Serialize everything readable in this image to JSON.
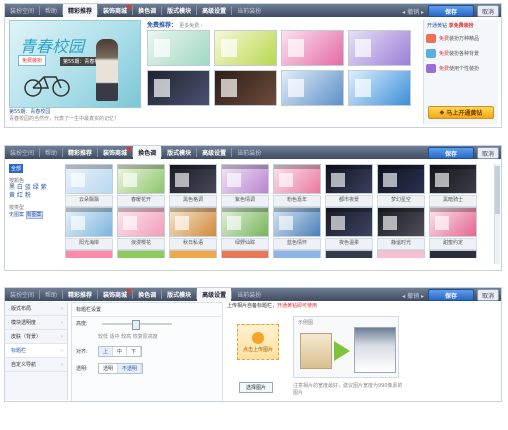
{
  "colors": {
    "accent": "#2a6acb",
    "toolbar": "#4f5d73",
    "save": "#3a7fd8",
    "vip": "#f2a913"
  },
  "panel1": {
    "toolbar": {
      "tabs": [
        {
          "label": "装扮空间",
          "type": "sub"
        },
        {
          "label": "帮助",
          "type": "sub"
        },
        {
          "label": "精彩推荐",
          "type": "active"
        },
        {
          "label": "装饰商城",
          "type": "bold",
          "badge": true
        },
        {
          "label": "换色调",
          "type": "bold"
        },
        {
          "label": "版式模块",
          "type": "bold"
        },
        {
          "label": "高级设置",
          "type": "bold"
        },
        {
          "label": "当前装扮",
          "type": "sub"
        }
      ],
      "nav": "◂ 撤销 ▸",
      "save_label": "保存",
      "cancel_label": "取消"
    },
    "featured": {
      "title": "青春校园",
      "badge": "免费装扮",
      "sub": "第55期：青春校园",
      "caption1": "第55期：青春校园",
      "caption2": "青春校园的当然作，代表了一生中最真实的记忆！"
    },
    "grid": {
      "title": "免费推荐：",
      "sub": "更多免费 ›",
      "items": [
        {
          "name": "t1",
          "c1": "#eaf6f0",
          "c2": "#9fd8c0"
        },
        {
          "name": "t2",
          "c1": "#f6f9d6",
          "c2": "#b8d84e"
        },
        {
          "name": "t3",
          "c1": "#fbe1ef",
          "c2": "#e46aa5"
        },
        {
          "name": "t4",
          "c1": "#e7e0f6",
          "c2": "#9a7fd6"
        },
        {
          "name": "t5",
          "c1": "#1f2230",
          "c2": "#4b5270"
        },
        {
          "name": "t6",
          "c1": "#2c1e1a",
          "c2": "#6e4b3b"
        },
        {
          "name": "t7",
          "c1": "#e2eef9",
          "c2": "#5c8fc7"
        },
        {
          "name": "t8",
          "c1": "#dcefff",
          "c2": "#3d8fd8"
        }
      ]
    },
    "side": {
      "title_pre": "开通黄钻",
      "title_hl": "享免费装扮",
      "items": [
        {
          "pre": "免费",
          "text": "装扮万种精品",
          "color": "#f06f55"
        },
        {
          "pre": "免费",
          "text": "装扮各种背景",
          "color": "#5aaee0"
        },
        {
          "pre": "免费",
          "text": "使用个性装扮",
          "color": "#9a6fd6"
        }
      ],
      "vip_label": "马上开通黄钻"
    }
  },
  "panel2": {
    "toolbar": {
      "tabs": [
        {
          "label": "装扮空间",
          "type": "sub"
        },
        {
          "label": "帮助",
          "type": "sub"
        },
        {
          "label": "精彩推荐",
          "type": "bold"
        },
        {
          "label": "装饰商城",
          "type": "bold",
          "badge": true
        },
        {
          "label": "换色调",
          "type": "active"
        },
        {
          "label": "版式模块",
          "type": "bold"
        },
        {
          "label": "高级设置",
          "type": "bold"
        },
        {
          "label": "当前装扮",
          "type": "sub"
        }
      ],
      "save_label": "保存",
      "cancel_label": "取消"
    },
    "filter": {
      "all": "全部",
      "by_color": "按颜色",
      "colors": "黑 白 蓝 绿 紫 黄 红 粉",
      "by_type": "按类型",
      "types": [
        "无图案",
        "有图案"
      ]
    },
    "cards": [
      {
        "name": "云朵飘飘",
        "c1": "#e9f3fb",
        "c2": "#b9d7ef"
      },
      {
        "name": "春暖花开",
        "c1": "#f0f7e2",
        "c2": "#8cc56a"
      },
      {
        "name": "黑色格调",
        "c1": "#1b1b22",
        "c2": "#45485a"
      },
      {
        "name": "紫色情调",
        "c1": "#f2e6f7",
        "c2": "#b784cf"
      },
      {
        "name": "粉色嘉年",
        "c1": "#fbe4ee",
        "c2": "#e9799f"
      },
      {
        "name": "都市夜景",
        "c1": "#111320",
        "c2": "#3a3f5e"
      },
      {
        "name": "梦幻星空",
        "c1": "#0f1220",
        "c2": "#28324f"
      },
      {
        "name": "黑暗骑士",
        "c1": "#14141a",
        "c2": "#3c3c48"
      },
      {
        "name": "阳光海岸",
        "c1": "#e8f3fb",
        "c2": "#7db4dc"
      },
      {
        "name": "浪漫樱花",
        "c1": "#fde8ef",
        "c2": "#f19cb9"
      },
      {
        "name": "秋日私语",
        "c1": "#f7e7cf",
        "c2": "#d08a3d"
      },
      {
        "name": "绿野仙踪",
        "c1": "#e4f2df",
        "c2": "#77b45b"
      },
      {
        "name": "蓝色情怀",
        "c1": "#d7e7f6",
        "c2": "#4a7fb8"
      },
      {
        "name": "夜色温柔",
        "c1": "#191b28",
        "c2": "#3d4260"
      },
      {
        "name": "静谧时光",
        "c1": "#1d1d24",
        "c2": "#4d4d5b"
      },
      {
        "name": "甜蜜约定",
        "c1": "#fbe6ee",
        "c2": "#e6658f"
      }
    ],
    "extra_row_colors": [
      "#ff8aa8",
      "#8ccc5a",
      "#f0a94a",
      "#e87755",
      "#8db6e6",
      "#333a4a",
      "#f4c0d2",
      "#2c2f3e"
    ]
  },
  "panel3": {
    "toolbar": {
      "tabs": [
        {
          "label": "装扮空间",
          "type": "sub"
        },
        {
          "label": "帮助",
          "type": "sub"
        },
        {
          "label": "精彩推荐",
          "type": "bold"
        },
        {
          "label": "装饰商城",
          "type": "bold",
          "badge": true
        },
        {
          "label": "换色调",
          "type": "bold"
        },
        {
          "label": "版式模块",
          "type": "bold"
        },
        {
          "label": "高级设置",
          "type": "active"
        },
        {
          "label": "当前装扮",
          "type": "sub"
        }
      ],
      "nav": "◂ 撤销 ▸",
      "save_label": "保存",
      "cancel_label": "取消"
    },
    "menu": [
      {
        "label": "版式布局",
        "sel": false
      },
      {
        "label": "模块透明度",
        "sel": false
      },
      {
        "label": "皮肤（背景）",
        "sel": false
      },
      {
        "label": "标题栏",
        "sel": true
      },
      {
        "label": "自定义导航",
        "sel": false
      }
    ],
    "settings": {
      "title": "标题栏设置",
      "height_label": "高度:",
      "height_marks": "较低  适中  较高  恢复原高度",
      "align_label": "对齐:",
      "align_opts": [
        "上",
        "中",
        "下"
      ],
      "trans_label": "透明:",
      "trans_opts": [
        "透明",
        "不透明"
      ]
    },
    "upload": {
      "title_pre": "上传相片自备标题栏",
      "title_hl": "开通黄钻即可使用",
      "dz_label": "点击上传图片",
      "choose_label": "选择图片",
      "preview_label": "示例图",
      "note": "注意相片的宽度最好，建议图片宽度为990像素的图片"
    }
  }
}
